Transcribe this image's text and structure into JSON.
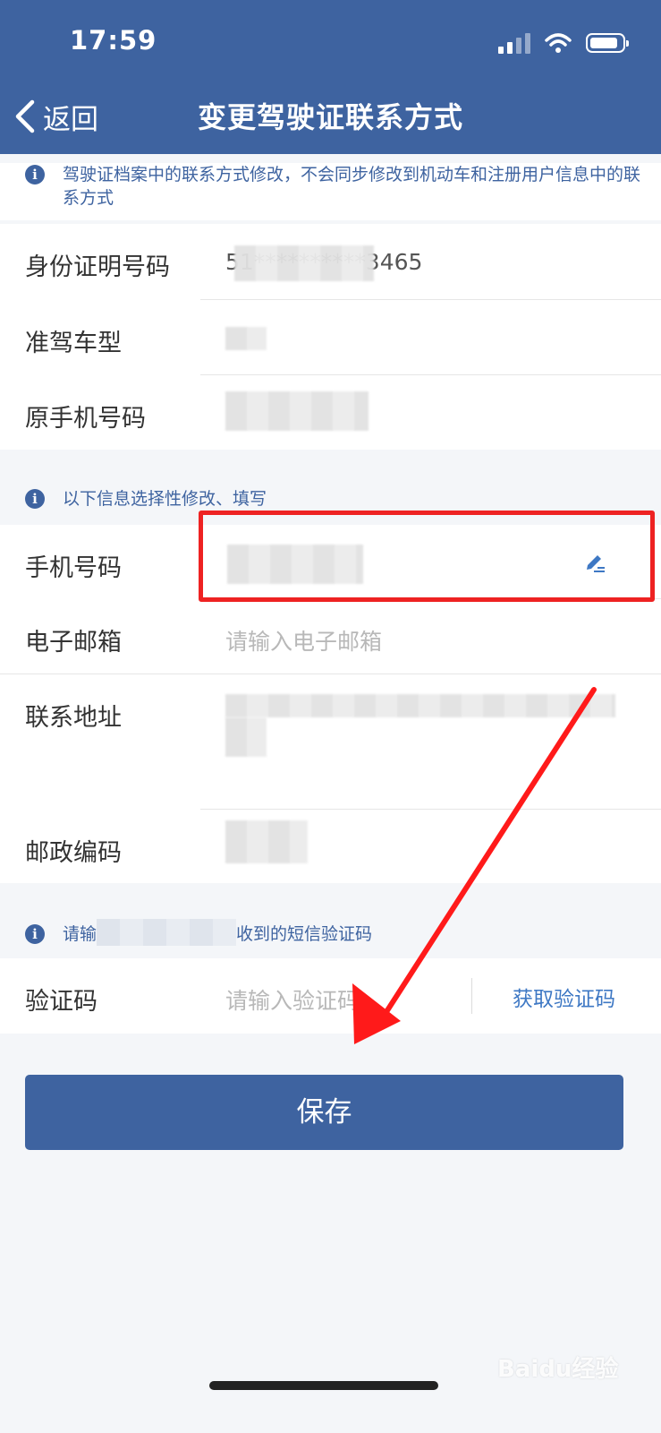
{
  "status_bar": {
    "time": "17:59"
  },
  "header": {
    "back_label": "返回",
    "title": "变更驾驶证联系方式"
  },
  "notice_top": "驾驶证档案中的联系方式修改，不会同步修改到机动车和注册用户信息中的联系方式",
  "readonly": {
    "id_label": "身份证明号码",
    "id_value": "51**********3465",
    "class_label": "准驾车型",
    "orig_phone_label": "原手机号码"
  },
  "notice_optional": "以下信息选择性修改、填写",
  "form": {
    "phone_label": "手机号码",
    "email_label": "电子邮箱",
    "email_placeholder": "请输入电子邮箱",
    "address_label": "联系地址",
    "postal_label": "邮政编码"
  },
  "notice_sms": {
    "prefix": "请输",
    "suffix": "收到的短信验证码"
  },
  "verify": {
    "label": "验证码",
    "placeholder": "请输入验证码",
    "get_code": "获取验证码"
  },
  "save_label": "保存",
  "watermark": "Baidu经验",
  "colors": {
    "primary": "#3e63a0",
    "link": "#3e78c4",
    "highlight": "#ee2222",
    "arrow": "#ff1a1a"
  }
}
